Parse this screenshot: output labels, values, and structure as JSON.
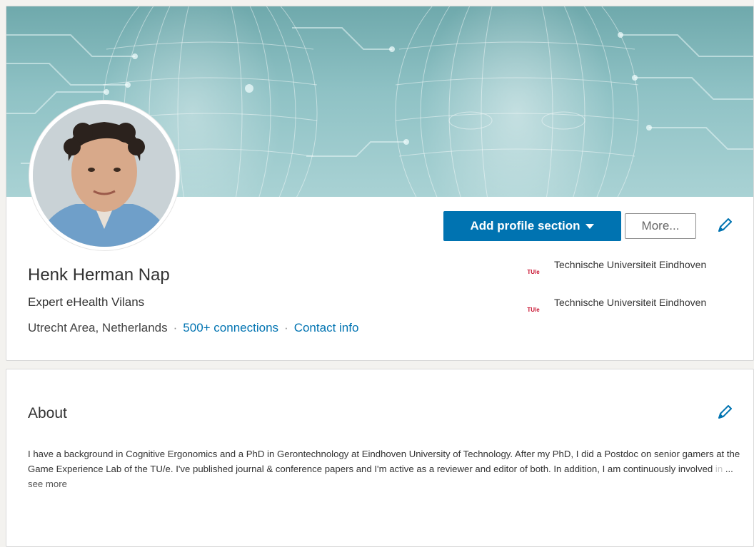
{
  "profile": {
    "name": "Henk Herman Nap",
    "headline": "Expert eHealth Vilans",
    "location": "Utrecht Area, Netherlands",
    "separator": "·",
    "connections": "500+ connections",
    "contact_info": "Contact info"
  },
  "actions": {
    "add_section_label": "Add profile section",
    "more_label": "More..."
  },
  "education": [
    {
      "logo_text": "TU/e",
      "school": "Technische Universiteit Eindhoven"
    },
    {
      "logo_text": "TU/e",
      "school": "Technische Universiteit Eindhoven"
    }
  ],
  "about": {
    "title": "About",
    "text_visible": "I have a background in Cognitive Ergonomics and a PhD in Gerontechnology at Eindhoven University of Technology. After my PhD, I did a Postdoc on senior gamers at the Game Experience Lab of the TU/e. I've published journal & conference papers and I'm active as a reviewer and editor of both. In addition, I am continuously involved ",
    "text_faded": "in",
    "ellipsis": " ... ",
    "see_more": "see more"
  },
  "colors": {
    "primary": "#0073b1",
    "tue_red": "#c8102e",
    "banner_teal": "#8fc2c5"
  },
  "icons": {
    "edit": "pencil-icon",
    "dropdown": "caret-down-icon"
  }
}
